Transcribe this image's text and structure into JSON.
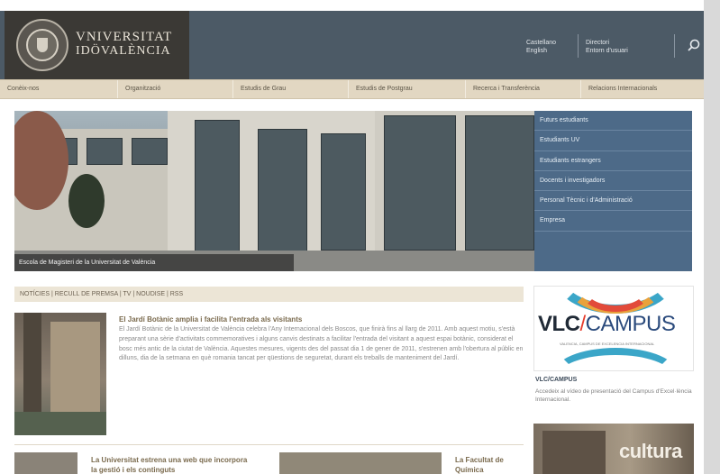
{
  "header": {
    "logo_line1": "VNIVERSITAT",
    "logo_line2": "IDÖVALÈNCIA",
    "lang_links": [
      "Castellano",
      "English"
    ],
    "user_links": [
      "Directori",
      "Entorn d'usuari"
    ],
    "search_icon": "search-icon"
  },
  "nav": {
    "items": [
      "Conèix-nos",
      "Organització",
      "Estudis de Grau",
      "Estudis de Postgrau",
      "Recerca i Transferència",
      "Relacions Internacionals"
    ]
  },
  "hero": {
    "caption": "Escola de Magisteri de la Universitat de València",
    "side_nav": [
      "Futurs estudiants",
      "Estudiants UV",
      "Estudiants estrangers",
      "Docents i investigadors",
      "Personal Tècnic i d'Administració",
      "Empresa"
    ]
  },
  "news": {
    "bar": "NOTÍCIES | RECULL DE PREMSA | TV | NOUDISE | RSS",
    "main_title": "El Jardí Botànic amplia i facilita l'entrada als visitants",
    "main_body": "El Jardí Botànic de la Universitat de València celebra l'Any Internacional dels Boscos, que finirà fins al llarg de 2011. Amb aquest motiu, s'està preparant una sèrie d'activitats commemoratives i alguns canvis destinats a facilitar l'entrada del visitant a aquest espai botànic, considerat el bosc més antic de la ciutat de València. Aquestes mesures, vigents des del passat dia 1 de gener de 2011, s'estrenen amb l'obertura al públic en dilluns, dia de la setmana en què romania tancat per qüestions de seguretat, durant els treballs de manteniment del Jardí.",
    "item2_title": "La Universitat estrena una web que incorpora la gestió i els continguts",
    "item3_title": "La Facultat de Química"
  },
  "sidebar": {
    "vlc_brand": "VLC",
    "vlc_slash": "/",
    "vlc_campus": "CAMPUS",
    "vlc_sub": "VALENCIA, CAMPUS DE EXCELENCIA INTERNACIONAL",
    "vlc_label": "VLC/CAMPUS",
    "vlc_desc": "Accedeix al vídeo de presentació del Campus d'Excel·lència Internacional.",
    "culture_text": "cultura"
  },
  "colors": {
    "header_bg": "#4c5a66",
    "logo_bg": "#3b3935",
    "nav_bg": "#e2d7c2",
    "side_nav_bg": "#4d6a88",
    "news_title": "#7a6a4d",
    "vlc_red": "#e63c2c"
  }
}
